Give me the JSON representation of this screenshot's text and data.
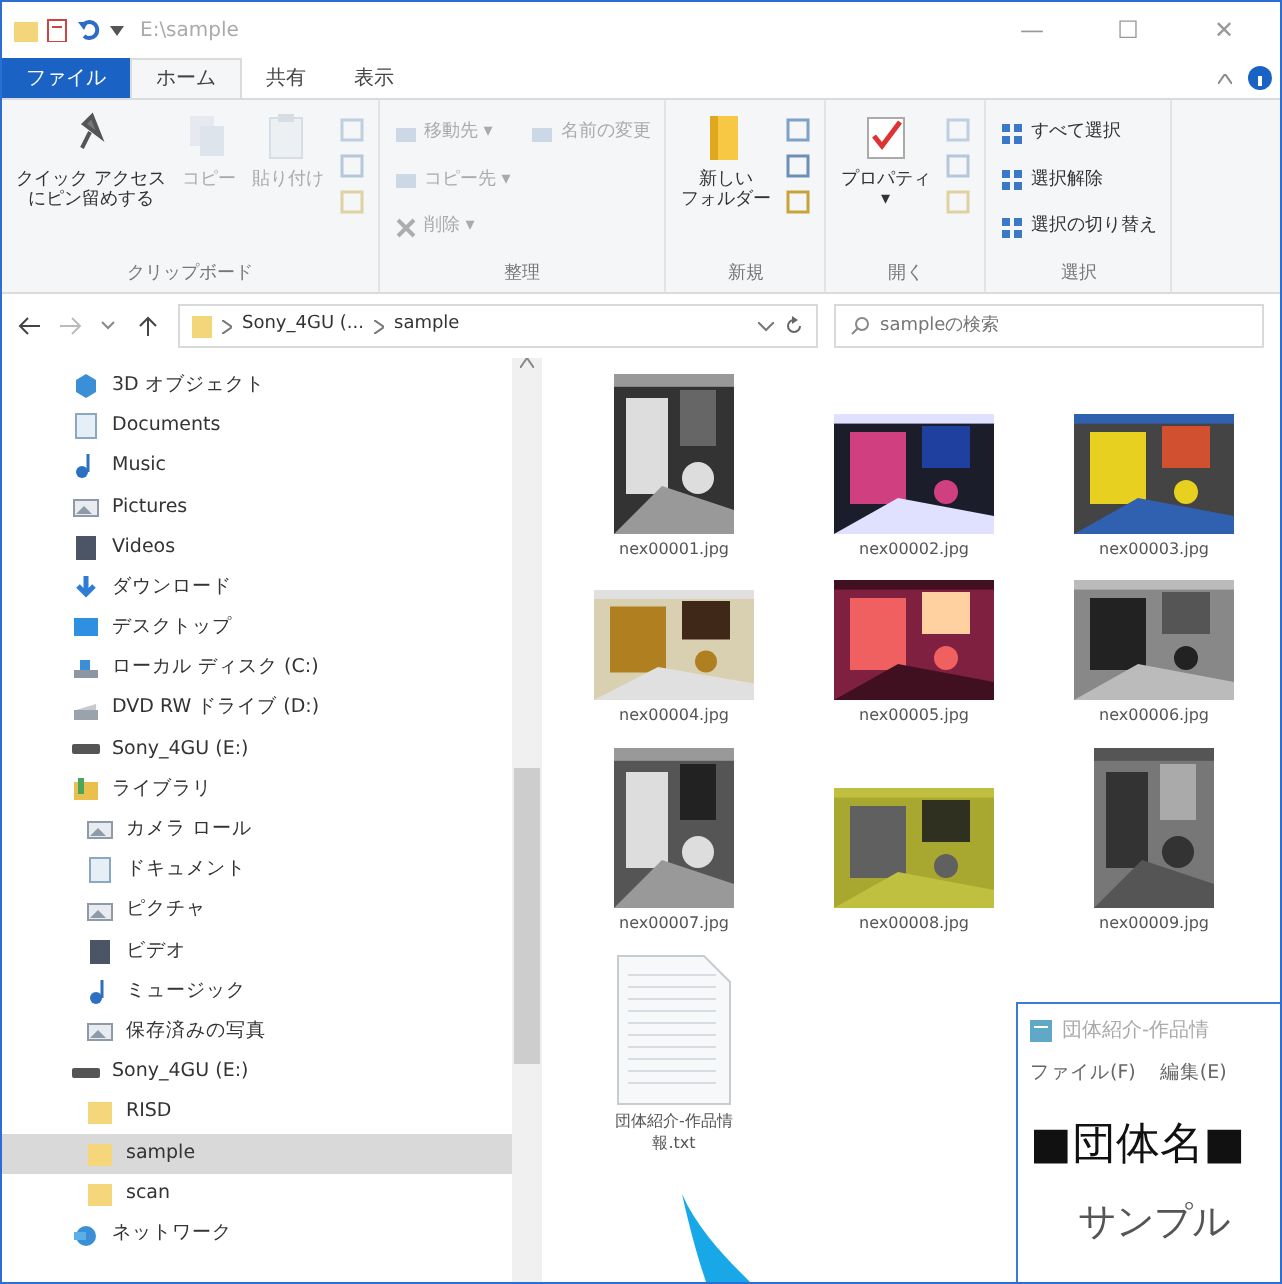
{
  "window": {
    "title": "E:\\sample",
    "controls": [
      "—",
      "☐",
      "✕"
    ]
  },
  "ribbon_tabs": [
    {
      "label": "ファイル",
      "kind": "file",
      "selected": false
    },
    {
      "label": "ホーム",
      "kind": "tab",
      "selected": true
    },
    {
      "label": "共有",
      "kind": "tab",
      "selected": false
    },
    {
      "label": "表示",
      "kind": "tab",
      "selected": false
    }
  ],
  "ribbon_groups": [
    {
      "label": "クリップボード",
      "items": [
        {
          "lines": [
            "クイック アクセス",
            "にピン留めする"
          ],
          "kind": "large",
          "disabled": false
        },
        {
          "lines": [
            "コピー"
          ],
          "kind": "large",
          "disabled": true
        },
        {
          "lines": [
            "貼り付け"
          ],
          "kind": "large",
          "disabled": true
        },
        {
          "kind": "stack",
          "disabled": true
        }
      ]
    },
    {
      "label": "整理",
      "items": [
        {
          "label": "移動先 ▾",
          "kind": "small",
          "disabled": true
        },
        {
          "label": "コピー先 ▾",
          "kind": "small",
          "disabled": true
        },
        {
          "label": "削除 ▾",
          "kind": "small",
          "disabled": true
        },
        {
          "label": "名前の変更",
          "kind": "small",
          "disabled": true
        }
      ]
    },
    {
      "label": "新規",
      "items": [
        {
          "lines": [
            "新しい",
            "フォルダー"
          ],
          "kind": "large",
          "disabled": false
        },
        {
          "kind": "stack",
          "disabled": false
        }
      ]
    },
    {
      "label": "開く",
      "items": [
        {
          "lines": [
            "プロパティ",
            "▾"
          ],
          "kind": "large",
          "disabled": false
        },
        {
          "kind": "stack",
          "disabled": true
        }
      ]
    },
    {
      "label": "選択",
      "items": [
        {
          "label": "すべて選択",
          "kind": "small",
          "disabled": false
        },
        {
          "label": "選択解除",
          "kind": "small",
          "disabled": false
        },
        {
          "label": "選択の切り替え",
          "kind": "small",
          "disabled": false
        }
      ]
    }
  ],
  "address": {
    "path": [
      "Sony_4GU (...",
      "sample"
    ],
    "search_placeholder": "sampleの検索"
  },
  "sidebar": {
    "items": [
      {
        "label": "3D オブジェクト",
        "kind": "cube"
      },
      {
        "label": "Documents",
        "kind": "doc"
      },
      {
        "label": "Music",
        "kind": "music"
      },
      {
        "label": "Pictures",
        "kind": "pic"
      },
      {
        "label": "Videos",
        "kind": "video"
      },
      {
        "label": "ダウンロード",
        "kind": "download"
      },
      {
        "label": "デスクトップ",
        "kind": "desktop"
      },
      {
        "label": "ローカル ディスク (C:)",
        "kind": "disk"
      },
      {
        "label": "DVD RW ドライブ (D:)",
        "kind": "dvd"
      },
      {
        "label": "Sony_4GU (E:)",
        "kind": "usb"
      },
      {
        "label": "ライブラリ",
        "kind": "library",
        "children": [
          {
            "label": "カメラ ロール",
            "kind": "pic"
          },
          {
            "label": "ドキュメント",
            "kind": "doc"
          },
          {
            "label": "ピクチャ",
            "kind": "pic"
          },
          {
            "label": "ビデオ",
            "kind": "video"
          },
          {
            "label": "ミュージック",
            "kind": "music"
          },
          {
            "label": "保存済みの写真",
            "kind": "pic"
          }
        ]
      },
      {
        "label": "Sony_4GU (E:)",
        "kind": "usb",
        "children": [
          {
            "label": "RISD",
            "kind": "folder",
            "selected": false
          },
          {
            "label": "sample",
            "kind": "folder",
            "selected": true
          },
          {
            "label": "scan",
            "kind": "folder",
            "selected": false
          }
        ]
      },
      {
        "label": "ネットワーク",
        "kind": "network"
      }
    ]
  },
  "files": [
    {
      "name": "nex00001.jpg",
      "kind": "picture"
    },
    {
      "name": "nex00002.jpg",
      "kind": "picture"
    },
    {
      "name": "nex00003.jpg",
      "kind": "picture"
    },
    {
      "name": "nex00004.jpg",
      "kind": "picture"
    },
    {
      "name": "nex00005.jpg",
      "kind": "picture"
    },
    {
      "name": "nex00006.jpg",
      "kind": "picture"
    },
    {
      "name": "nex00007.jpg",
      "kind": "picture"
    },
    {
      "name": "nex00008.jpg",
      "kind": "picture"
    },
    {
      "name": "nex00009.jpg",
      "kind": "picture"
    },
    {
      "name": "団体紹介-作品情報.txt",
      "kind": "text"
    }
  ],
  "notepad": {
    "title": "団体紹介-作品情",
    "menu": [
      "ファイル(F)",
      "編集(E)"
    ],
    "lines": [
      "■団体名■",
      "サンプル"
    ]
  }
}
